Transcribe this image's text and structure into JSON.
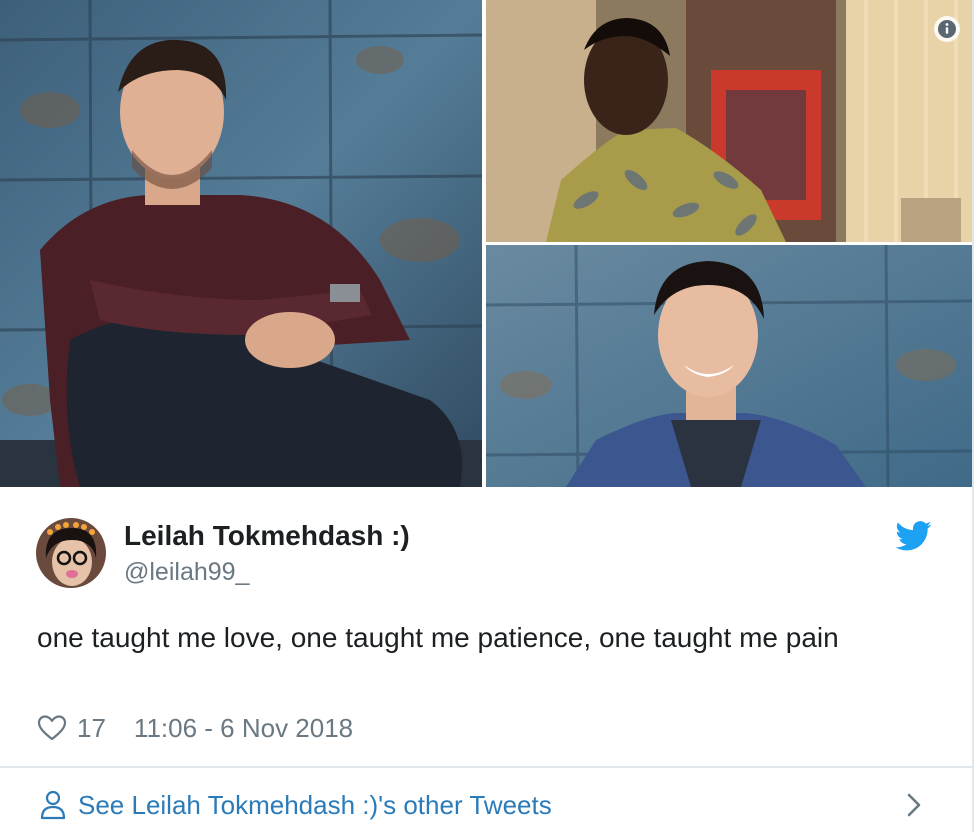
{
  "tweet": {
    "author_name": "Leilah Tokmehdash :)",
    "author_handle": "@leilah99_",
    "text": "one taught me love, one taught me patience, one taught me pain",
    "like_count": "17",
    "timestamp": "11:06 - 6 Nov 2018"
  },
  "footer": {
    "other_tweets_label": "See Leilah Tokmehdash :)'s other Tweets"
  },
  "icons": {
    "info": "info-icon",
    "twitter_bird": "twitter-bird-icon",
    "heart": "heart-icon",
    "person": "person-icon",
    "chevron": "chevron-right-icon"
  },
  "colors": {
    "twitter_blue": "#1da1f2",
    "link_blue": "#2b7bb9",
    "secondary_text": "#697882",
    "primary_text": "#1c2022",
    "divider": "#e1e8ed"
  }
}
